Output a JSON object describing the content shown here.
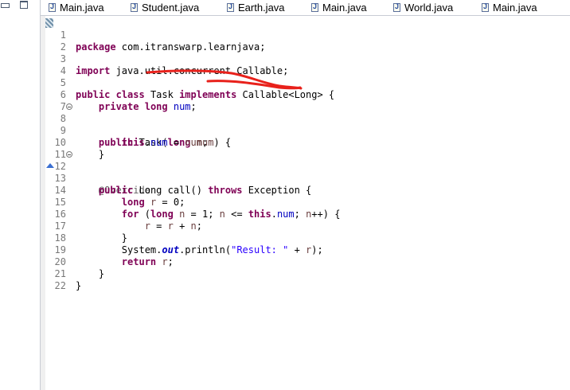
{
  "tabs": [
    {
      "label": "Main.java"
    },
    {
      "label": "Student.java"
    },
    {
      "label": "Earth.java"
    },
    {
      "label": "Main.java"
    },
    {
      "label": "World.java"
    },
    {
      "label": "Main.java"
    }
  ],
  "editor": {
    "line_numbers": [
      "1",
      "2",
      "3",
      "4",
      "5",
      "6",
      "7",
      "8",
      "9",
      "10",
      "11",
      "12",
      "13",
      "14",
      "15",
      "16",
      "17",
      "18",
      "19",
      "20",
      "21",
      "22"
    ],
    "code": {
      "l1": [
        "package",
        " com.itranswarp.learnjava;"
      ],
      "l3": [
        "import",
        " java.util.concurrent.Callable;"
      ],
      "l5": [
        "public",
        " ",
        "class",
        " Task ",
        "implements",
        " Callable<Long> {"
      ],
      "l6": [
        "    ",
        "private",
        " ",
        "long",
        " ",
        "num",
        ";"
      ],
      "l8": [
        "    ",
        "public",
        " Task(",
        "long",
        " ",
        "num",
        ") {"
      ],
      "l9": [
        "        ",
        "this",
        ".",
        "num",
        " = ",
        "num",
        ";"
      ],
      "l10": [
        "    }"
      ],
      "l12": [
        "    ",
        "@Override"
      ],
      "l13": [
        "    ",
        "public",
        " Long call() ",
        "throws",
        " Exception {"
      ],
      "l14": [
        "        ",
        "long",
        " ",
        "r",
        " = 0;"
      ],
      "l15": [
        "        ",
        "for",
        " (",
        "long",
        " ",
        "n",
        " = 1; ",
        "n",
        " <= ",
        "this",
        ".",
        "num",
        "; ",
        "n",
        "++) {"
      ],
      "l16": [
        "            ",
        "r",
        " = ",
        "r",
        " + ",
        "n",
        ";"
      ],
      "l17": [
        "        }"
      ],
      "l18": [
        "        System.",
        "out",
        ".println(",
        "\"Result: \"",
        " + ",
        "r",
        ");"
      ],
      "l19": [
        "        ",
        "return",
        " ",
        "r",
        ";"
      ],
      "l20": [
        "    }"
      ],
      "l21": [
        "}"
      ]
    },
    "colors": {
      "keyword": "#7f0055",
      "string": "#2a00ff",
      "field": "#0000c0",
      "annotation": "#646464",
      "line_number": "#787878"
    }
  }
}
